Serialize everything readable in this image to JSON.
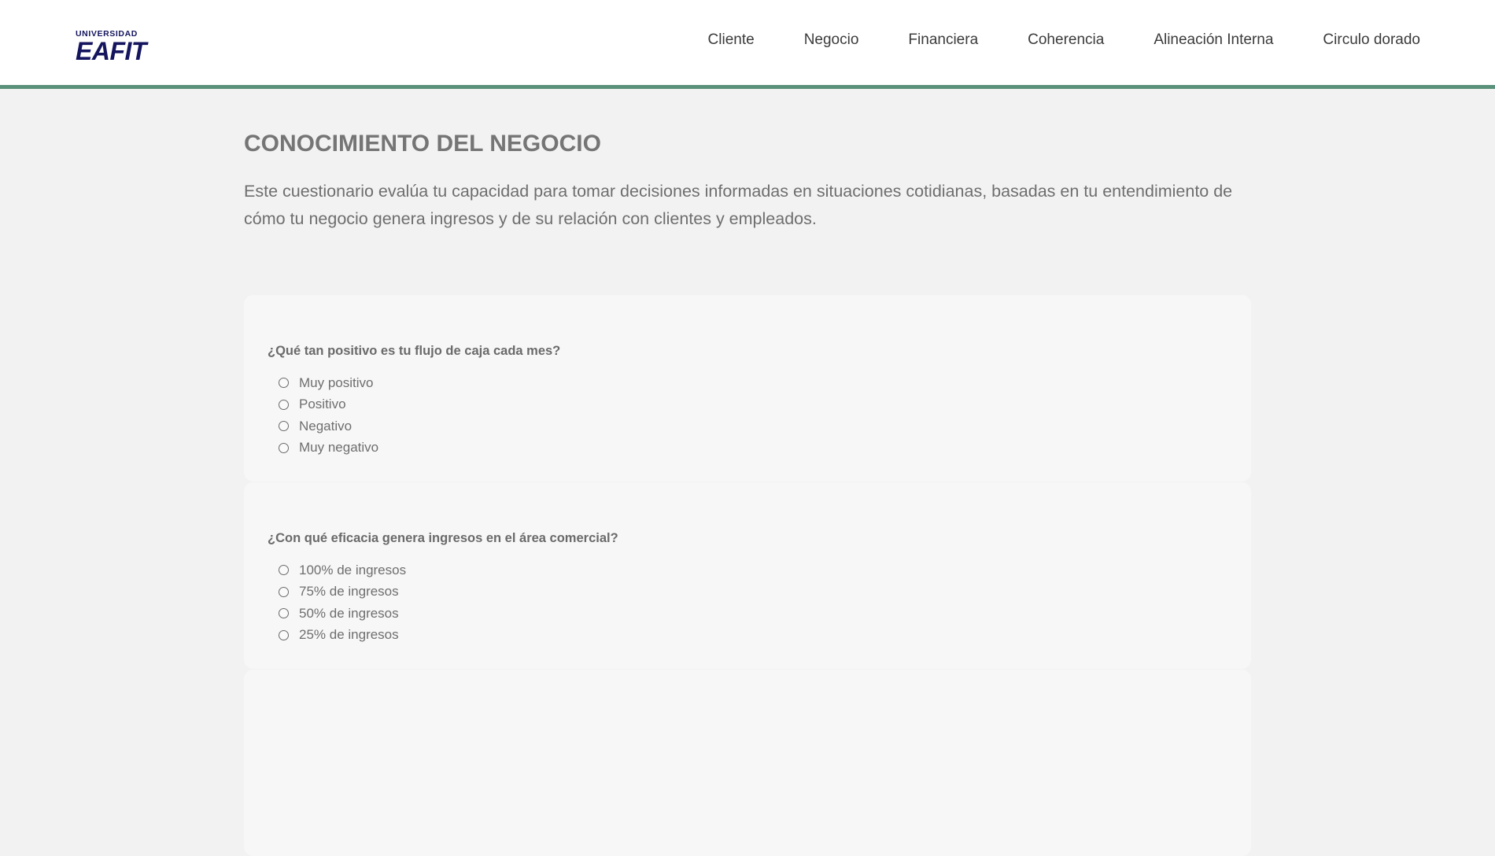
{
  "brand": {
    "top": "UNIVERSIDAD",
    "main": "EAFIT",
    "color": "#14155e"
  },
  "accent_color": "#5a917a",
  "nav": [
    "Cliente",
    "Negocio",
    "Financiera",
    "Coherencia",
    "Alineación Interna",
    "Circulo dorado"
  ],
  "page": {
    "title": "CONOCIMIENTO DEL NEGOCIO",
    "intro": "Este cuestionario evalúa tu capacidad para tomar decisiones informadas en situaciones cotidianas, basadas en tu entendimiento de cómo tu negocio genera ingresos y de su relación con clientes y empleados."
  },
  "questions": [
    {
      "text": "¿Qué tan positivo es tu flujo de caja cada mes?",
      "options": [
        "Muy positivo",
        "Positivo",
        "Negativo",
        "Muy negativo"
      ]
    },
    {
      "text": "¿Con qué eficacia genera ingresos en el área comercial?",
      "options": [
        "100% de ingresos",
        "75% de ingresos",
        "50% de ingresos",
        "25% de ingresos"
      ]
    }
  ]
}
